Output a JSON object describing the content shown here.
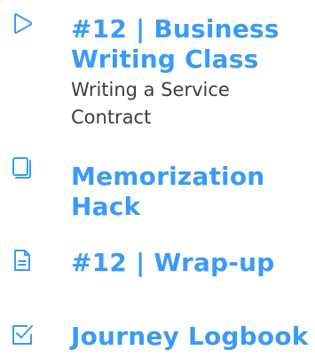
{
  "colors": {
    "accent": "#3a9bf7",
    "icon": "#3a9bf7",
    "subtitle": "#3d3d3d",
    "background": "#ffffff"
  },
  "items": [
    {
      "icon": "play-icon",
      "title": "#12 | Business Writing Class",
      "subtitle": "Writing a Service Contract"
    },
    {
      "icon": "stack-icon",
      "title": "Memorization Hack"
    },
    {
      "icon": "document-icon",
      "title": "#12 | Wrap-up"
    },
    {
      "icon": "checkbox-icon",
      "title": "Journey Logbook"
    }
  ]
}
